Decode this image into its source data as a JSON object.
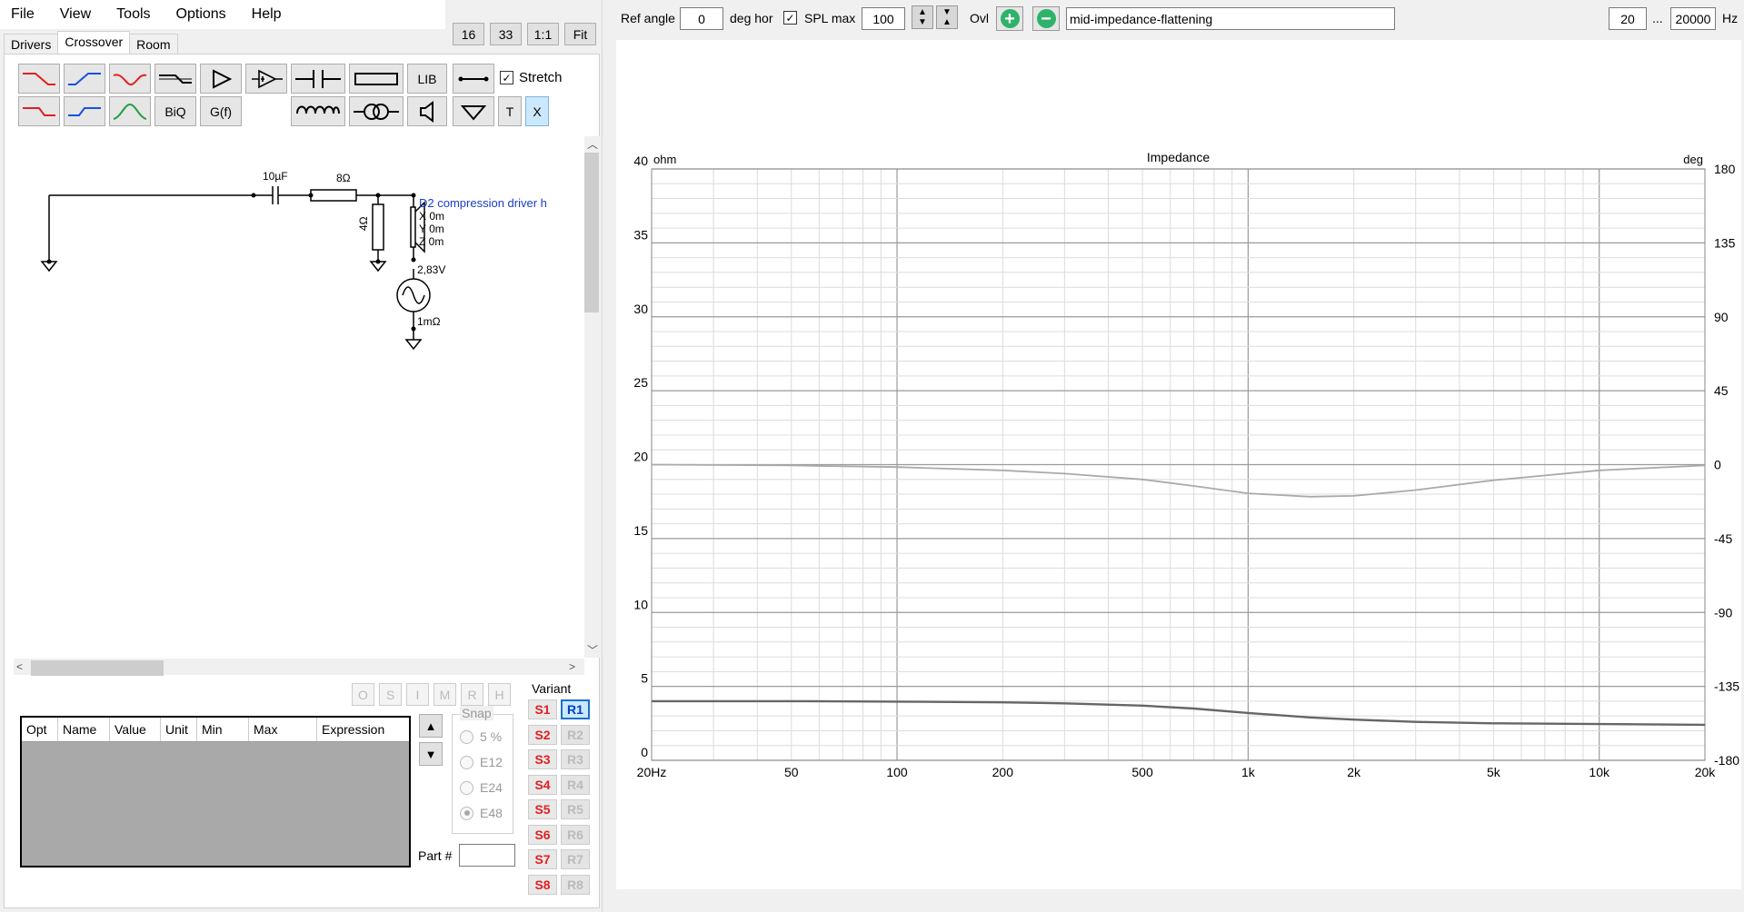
{
  "menu": {
    "items": [
      "File",
      "View",
      "Tools",
      "Options",
      "Help"
    ]
  },
  "zoom_buttons": [
    "16",
    "33",
    "1:1",
    "Fit"
  ],
  "tabs": [
    "Drivers",
    "Crossover",
    "Room"
  ],
  "active_tab": "Crossover",
  "toolbar": {
    "lib_label": "LIB",
    "biq_label": "BiQ",
    "gf_label": "G(f)",
    "t_label": "T",
    "x_label": "X",
    "stretch_label": "Stretch",
    "stretch_checked": true
  },
  "schematic": {
    "capacitor": "10µF",
    "resistor_series": "8Ω",
    "resistor_shunt": "4Ω",
    "driver_name": "D2 compression driver h",
    "driver_x": "X 0m",
    "driver_y": "Y 0m",
    "driver_z": "Z 0m",
    "source_voltage": "2,83V",
    "source_resistance": "1mΩ"
  },
  "opt_buttons": [
    "O",
    "S",
    "I",
    "M",
    "R",
    "H"
  ],
  "table": {
    "headers": [
      "Opt",
      "Name",
      "Value",
      "Unit",
      "Min",
      "Max",
      "Expression"
    ]
  },
  "snap": {
    "label": "Snap",
    "options": [
      "5 %",
      "E12",
      "E24",
      "E48"
    ],
    "selected": "E48"
  },
  "part_label": "Part #",
  "variant": {
    "label": "Variant",
    "s": [
      "S1",
      "S2",
      "S3",
      "S4",
      "S5",
      "S6",
      "S7",
      "S8"
    ],
    "r": [
      "R1",
      "R2",
      "R3",
      "R4",
      "R5",
      "R6",
      "R7",
      "R8"
    ],
    "selected": "R1"
  },
  "topbar": {
    "ref_angle_label": "Ref angle",
    "ref_angle_value": "0",
    "deg_hor_label": "deg hor",
    "spl_max_label": "SPL max",
    "spl_max_checked": true,
    "spl_max_value": "100",
    "ovl_label": "Ovl",
    "name_value": "mid-impedance-flattening",
    "freq_min": "20",
    "freq_sep": "...",
    "freq_max": "20000",
    "hz_label": "Hz"
  },
  "chart_data": {
    "type": "line",
    "title": "Impedance",
    "left_unit": "ohm",
    "right_unit": "deg",
    "x_scale": "log",
    "xlim": [
      20,
      20000
    ],
    "ylim": [
      0,
      40
    ],
    "y2lim": [
      -180,
      180
    ],
    "x_ticks": [
      "20Hz",
      "50",
      "100",
      "200",
      "500",
      "1k",
      "2k",
      "5k",
      "10k",
      "20k"
    ],
    "x_tick_values": [
      20,
      50,
      100,
      200,
      500,
      1000,
      2000,
      5000,
      10000,
      20000
    ],
    "y_ticks": [
      "0",
      "5",
      "10",
      "15",
      "20",
      "25",
      "30",
      "35",
      "40"
    ],
    "y2_ticks": [
      "-180",
      "-135",
      "-90",
      "-45",
      "0",
      "45",
      "90",
      "135",
      "180"
    ],
    "grid": true,
    "series": [
      {
        "color": "#666666",
        "axis": "left",
        "x": [
          20,
          50,
          100,
          200,
          300,
          500,
          700,
          1000,
          1500,
          2000,
          3000,
          5000,
          10000,
          20000
        ],
        "y": [
          4.0,
          4.0,
          3.97,
          3.92,
          3.85,
          3.7,
          3.5,
          3.2,
          2.9,
          2.75,
          2.6,
          2.5,
          2.45,
          2.4
        ]
      },
      {
        "color": "#aaaaaa",
        "axis": "right",
        "x": [
          20,
          50,
          100,
          200,
          300,
          500,
          700,
          1000,
          1500,
          2000,
          3000,
          5000,
          10000,
          20000
        ],
        "y": [
          0,
          -0.5,
          -1.5,
          -3.5,
          -5.5,
          -9,
          -13,
          -17.5,
          -19.5,
          -19,
          -15.5,
          -9.5,
          -3.5,
          -0.5
        ]
      }
    ]
  }
}
